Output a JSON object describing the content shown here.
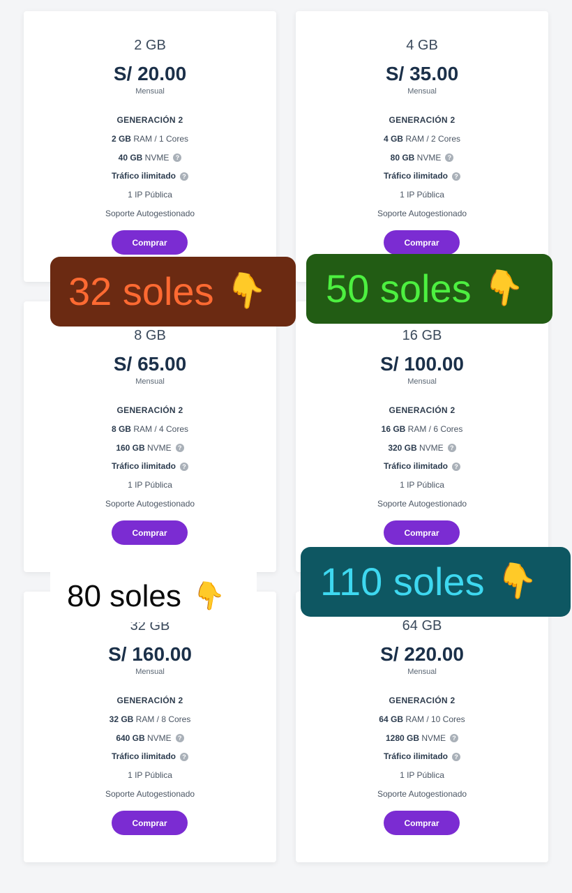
{
  "plans": [
    {
      "name": "2 GB",
      "price": "S/ 20.00",
      "period": "Mensual",
      "generation": "GENERACIÓN 2",
      "ram_value": "2 GB",
      "ram_rest": " RAM / 1 Cores",
      "disk_value": "40 GB",
      "disk_rest": " NVME",
      "traffic": "Tráfico ilimitado",
      "ip": "1 IP Pública",
      "support": "Soporte Autogestionado",
      "button": "Comprar"
    },
    {
      "name": "4 GB",
      "price": "S/ 35.00",
      "period": "Mensual",
      "generation": "GENERACIÓN 2",
      "ram_value": "4 GB",
      "ram_rest": " RAM / 2 Cores",
      "disk_value": "80 GB",
      "disk_rest": " NVME",
      "traffic": "Tráfico ilimitado",
      "ip": "1 IP Pública",
      "support": "Soporte Autogestionado",
      "button": "Comprar"
    },
    {
      "name": "8 GB",
      "price": "S/ 65.00",
      "period": "Mensual",
      "generation": "GENERACIÓN 2",
      "ram_value": "8 GB",
      "ram_rest": " RAM / 4 Cores",
      "disk_value": "160 GB",
      "disk_rest": " NVME",
      "traffic": "Tráfico ilimitado",
      "ip": "1 IP Pública",
      "support": "Soporte Autogestionado",
      "button": "Comprar"
    },
    {
      "name": "16 GB",
      "price": "S/ 100.00",
      "period": "Mensual",
      "generation": "GENERACIÓN 2",
      "ram_value": "16 GB",
      "ram_rest": " RAM / 6 Cores",
      "disk_value": "320 GB",
      "disk_rest": " NVME",
      "traffic": "Tráfico ilimitado",
      "ip": "1 IP Pública",
      "support": "Soporte Autogestionado",
      "button": "Comprar"
    },
    {
      "name": "32 GB",
      "price": "S/ 160.00",
      "period": "Mensual",
      "generation": "GENERACIÓN 2",
      "ram_value": "32 GB",
      "ram_rest": " RAM / 8 Cores",
      "disk_value": "640 GB",
      "disk_rest": " NVME",
      "traffic": "Tráfico ilimitado",
      "ip": "1 IP Pública",
      "support": "Soporte Autogestionado",
      "button": "Comprar"
    },
    {
      "name": "64 GB",
      "price": "S/ 220.00",
      "period": "Mensual",
      "generation": "GENERACIÓN 2",
      "ram_value": "64 GB",
      "ram_rest": " RAM / 10 Cores",
      "disk_value": "1280 GB",
      "disk_rest": " NVME",
      "traffic": "Tráfico ilimitado",
      "ip": "1 IP Pública",
      "support": "Soporte Autogestionado",
      "button": "Comprar"
    }
  ],
  "help_glyph": "?",
  "overlays": [
    {
      "text": "32 soles",
      "emoji": "👇",
      "bg": "#6b2a12",
      "color": "#ff6a32"
    },
    {
      "text": "50 soles",
      "emoji": "👇",
      "bg": "#225c14",
      "color": "#4df040"
    },
    {
      "text": "80 soles",
      "emoji": "👇",
      "bg": "#ffffff",
      "color": "#0a0a0a"
    },
    {
      "text": "110 soles",
      "emoji": "👇",
      "bg": "#0e5762",
      "color": "#3ed8f0"
    }
  ],
  "colors": {
    "button": "#7b2cd2",
    "price": "#1b3049",
    "background": "#f4f5f7"
  }
}
